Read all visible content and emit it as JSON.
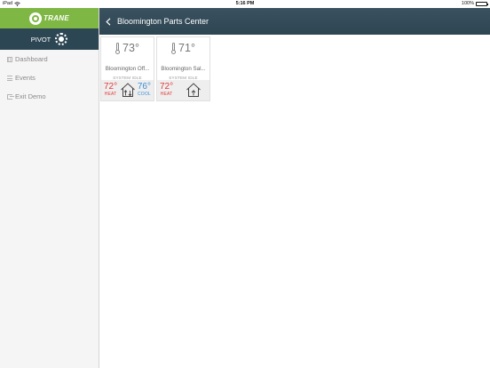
{
  "status_bar": {
    "device": "iPad",
    "time": "5:16 PM",
    "battery": "100%"
  },
  "sidebar": {
    "brand": "TRANE",
    "product": "PIVOT",
    "items": [
      {
        "label": "Dashboard",
        "icon": "grid-icon"
      },
      {
        "label": "Events",
        "icon": "list-icon"
      },
      {
        "label": "Exit Demo",
        "icon": "exit-icon"
      }
    ]
  },
  "header": {
    "title": "Bloomington Parts Center"
  },
  "cards": [
    {
      "temperature": "73°",
      "name": "Bloomington Off...",
      "status": "SYSTEM IDLE",
      "heat_setpoint": "72°",
      "heat_label": "HEAT",
      "cool_setpoint": "76°",
      "cool_label": "COOL",
      "mode": "auto"
    },
    {
      "temperature": "71°",
      "name": "Bloomington Sal...",
      "status": "SYSTEM IDLE",
      "heat_setpoint": "72°",
      "heat_label": "HEAT",
      "mode": "heat"
    }
  ],
  "colors": {
    "brand_green": "#7fb745",
    "nav_dark": "#2c4653",
    "header": "#3a5260",
    "heat": "#e23b3b",
    "cool": "#3b8fd6"
  }
}
